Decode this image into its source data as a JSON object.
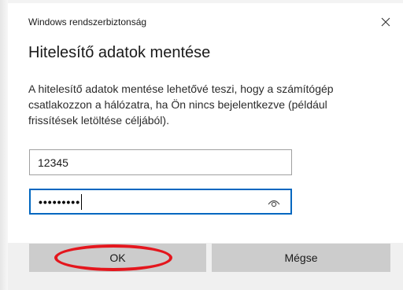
{
  "window": {
    "title": "Windows rendszerbiztonság",
    "close_icon": "close-icon"
  },
  "dialog": {
    "heading": "Hitelesítő adatok mentése",
    "message": "A hitelesítő adatok mentése lehetővé teszi, hogy a számítógép csatlakozzon a hálózatra, ha Ön nincs bejelentkezve (például frissítések letöltése céljából)."
  },
  "fields": {
    "username_value": "12345",
    "password_masked": "•••••••••",
    "reveal_icon": "eye-icon"
  },
  "buttons": {
    "ok_label": "OK",
    "cancel_label": "Mégse"
  },
  "colors": {
    "accent": "#0067c0",
    "annotation": "#e4161d",
    "button_bg": "#cccccc"
  }
}
